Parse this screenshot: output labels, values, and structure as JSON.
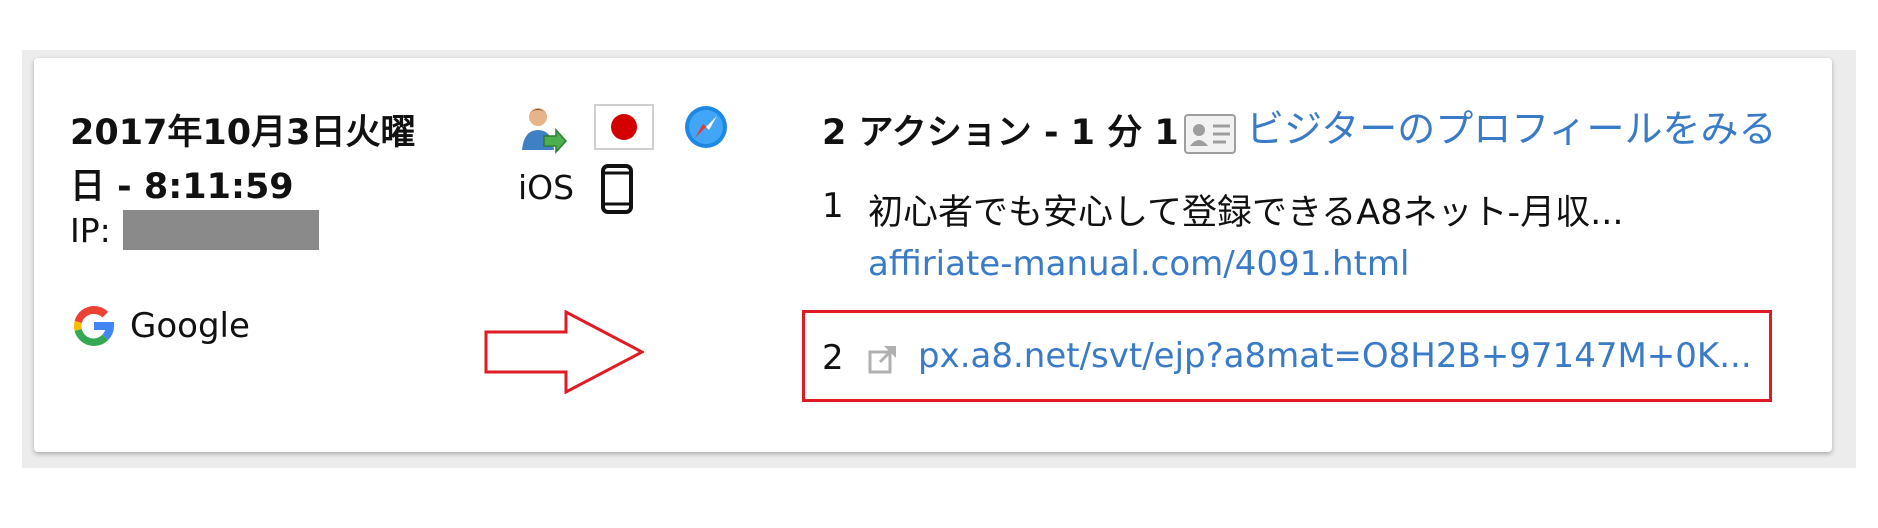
{
  "visit": {
    "datetime": "2017年10月3日火曜日 - 8:11:59",
    "ip_label": "IP:",
    "referrer": {
      "name": "Google",
      "icon": "google-icon"
    }
  },
  "device": {
    "visitor_icon": "returning-visitor-icon",
    "flag_icon": "japan-flag-icon",
    "browser_icon": "safari-icon",
    "os": "iOS",
    "device_icon": "smartphone-icon"
  },
  "actions": {
    "summary": "2 アクション - 1 分 1",
    "profile_link": "ビジターのプロフィールをみる",
    "items": [
      {
        "num": "1",
        "title": "初心者でも安心して登録できるA8ネット-月収...",
        "url": "affiriate-manual.com/4091.html"
      },
      {
        "num": "2",
        "url": "px.a8.net/svt/ejp?a8mat=O8H2B+97147M+0K..."
      }
    ]
  },
  "colors": {
    "link": "#3a7bc8",
    "highlight": "#e01b24",
    "arrow": "#e01b24"
  }
}
